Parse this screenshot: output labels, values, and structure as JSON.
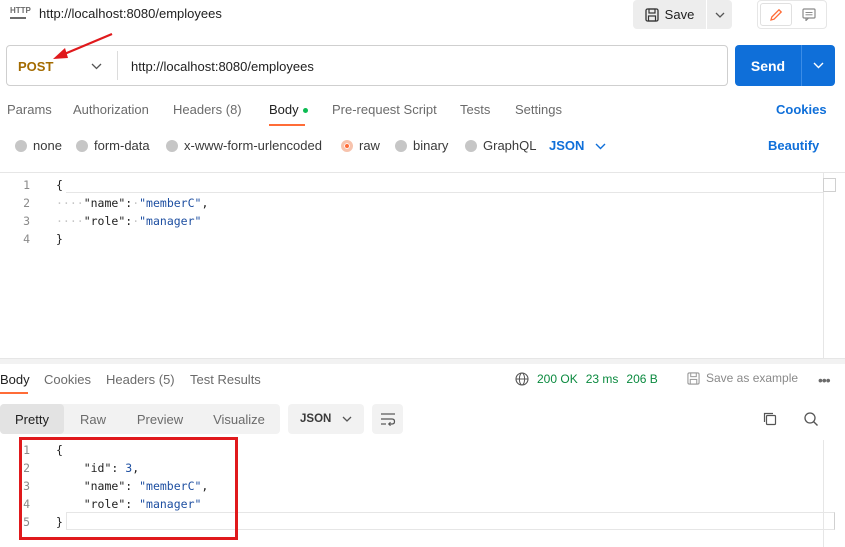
{
  "header": {
    "tab_icon": "http-icon",
    "tab_icon_label": "HTTP",
    "tab_title": "http://localhost:8080/employees",
    "save_label": "Save",
    "save_icon": "save-icon"
  },
  "request": {
    "method": "POST",
    "url": "http://localhost:8080/employees",
    "send_label": "Send",
    "method_color": "#a36b00",
    "send_color": "#0f6fd9"
  },
  "request_tabs": {
    "params": "Params",
    "authorization": "Authorization",
    "headers": "Headers (8)",
    "body": "Body",
    "pre_request": "Pre-request Script",
    "tests": "Tests",
    "settings": "Settings",
    "cookies": "Cookies",
    "active": "Body",
    "accent_color": "#ff6c37"
  },
  "body_types": {
    "none": "none",
    "form_data": "form-data",
    "urlencoded": "x-www-form-urlencoded",
    "raw": "raw",
    "binary": "binary",
    "graphql": "GraphQL",
    "selected": "raw",
    "format": "JSON",
    "beautify": "Beautify"
  },
  "request_body": {
    "line_numbers": [
      "1",
      "2",
      "3",
      "4"
    ],
    "line1": "{",
    "line2_key": "\"name\"",
    "line2_val": "\"memberC\"",
    "line3_key": "\"role\"",
    "line3_val": "\"manager\"",
    "line4": "}"
  },
  "response_tabs": {
    "body": "Body",
    "cookies": "Cookies",
    "headers": "Headers (5)",
    "test_results": "Test Results",
    "status": "200 OK",
    "time": "23 ms",
    "size": "206 B",
    "save_example": "Save as example",
    "status_color": "#0b8a3f"
  },
  "response_view": {
    "pretty": "Pretty",
    "raw": "Raw",
    "preview": "Preview",
    "visualize": "Visualize",
    "format": "JSON",
    "active": "Pretty"
  },
  "response_body": {
    "line_numbers": [
      "1",
      "2",
      "3",
      "4",
      "5"
    ],
    "line1": "{",
    "line2_key": "\"id\"",
    "line2_val": "3",
    "line3_key": "\"name\"",
    "line3_val": "\"memberC\"",
    "line4_key": "\"role\"",
    "line4_val": "\"manager\"",
    "line5": "}"
  },
  "annotations": {
    "highlight_color": "#e0191c"
  }
}
